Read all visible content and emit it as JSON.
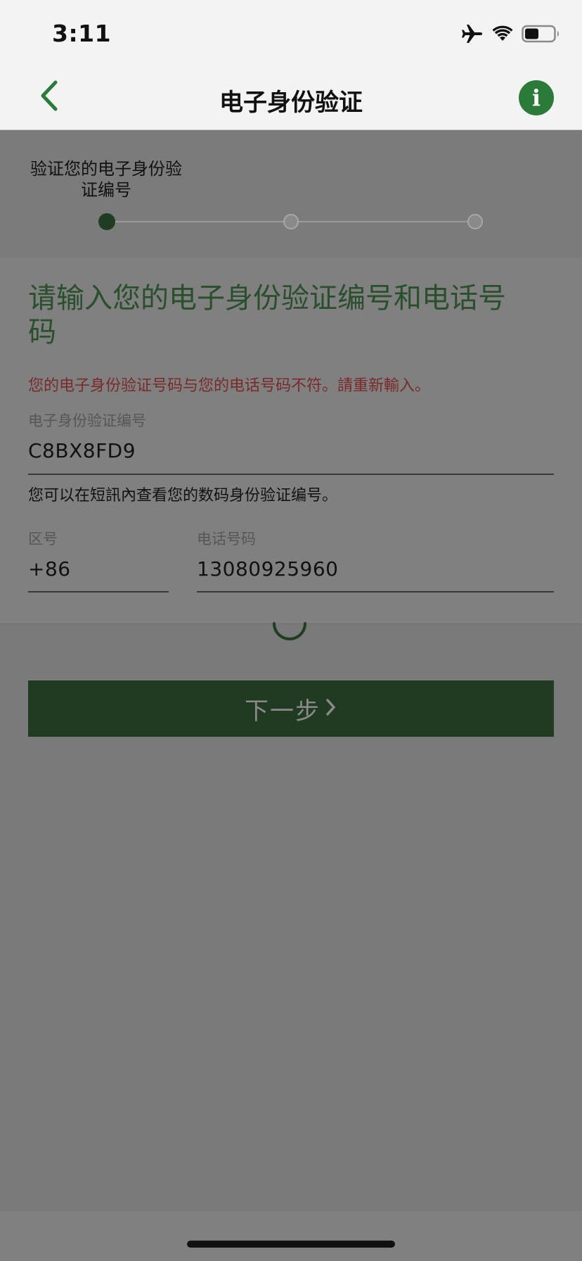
{
  "status_bar": {
    "time": "3:11",
    "icons": [
      "airplane-icon",
      "wifi-icon",
      "battery-icon"
    ]
  },
  "nav": {
    "title": "电子身份验证",
    "back_icon": "chevron-left-icon",
    "info_icon": "info-icon",
    "info_glyph": "i"
  },
  "stepper": {
    "current_step_label": "验证您的电子身份验证编号",
    "total_steps": 3,
    "current_step": 1
  },
  "form": {
    "heading": "请输入您的电子身份验证编号和电话号码",
    "error": "您的电子身份验证号码与您的电话号码不符。請重新輸入。",
    "eid_label": "电子身份验证编号",
    "eid_value": "C8BX8FD9",
    "hint": "您可以在短訊內查看您的数码身份验证编号。",
    "area_code_label": "区号",
    "area_code_value": "+86",
    "phone_label": "电话号码",
    "phone_value": "13080925960"
  },
  "actions": {
    "next_label": "下一步"
  },
  "colors": {
    "accent_green": "#2a7a3a",
    "button_green": "#213a22",
    "error_red": "#7a2a2a",
    "overlay_gray": "#7a7a7a"
  }
}
